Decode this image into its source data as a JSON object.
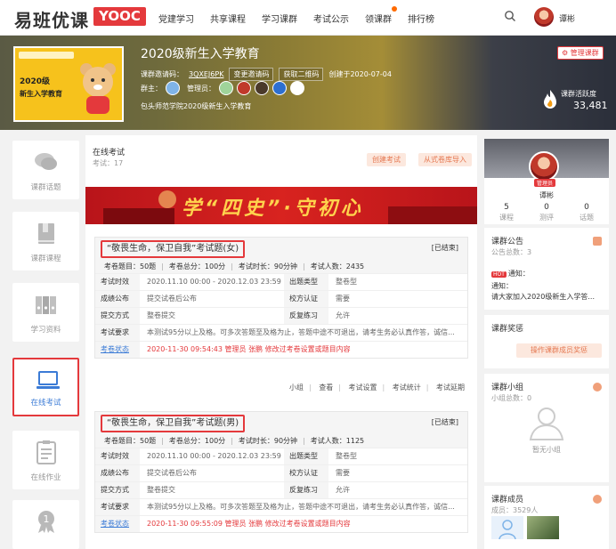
{
  "header": {
    "logo_text": "易班优课",
    "logo_badge": "YOOC",
    "nav": [
      "党建学习",
      "共享课程",
      "学习课群",
      "考试公示",
      "领课群",
      "排行榜"
    ],
    "user_name": "谭彬"
  },
  "banner": {
    "cover_line1": "2020级",
    "cover_line2": "新生入学教育",
    "title": "2020级新生入学教育",
    "invite_label": "课群邀请码：",
    "invite_code": "3QXEJ6PK",
    "change_code": "变更邀请码",
    "get_qr": "获取二维码",
    "created": "创建于2020-07-04",
    "owner_label": "群主：",
    "admin_label": "管理员：",
    "school": "包头师范学院2020级新生入学教育",
    "manage_button": "管理课群",
    "activity_label": "课群活跃度",
    "activity_value": "33,481"
  },
  "left_nav": [
    {
      "label": "课群话题",
      "icon": "chat-icon"
    },
    {
      "label": "课群课程",
      "icon": "book-icon"
    },
    {
      "label": "学习资料",
      "icon": "folder-icon"
    },
    {
      "label": "在线考试",
      "icon": "laptop-icon",
      "active": true
    },
    {
      "label": "在线作业",
      "icon": "clipboard-icon"
    },
    {
      "label": "",
      "icon": "medal-icon"
    }
  ],
  "main": {
    "section_title": "在线考试",
    "section_count": "考试：17",
    "create_exam": "创建考试",
    "import_exam": "从式卷库导入",
    "banner_text": "学“四史”·守初心",
    "exams": [
      {
        "title": "“敬畏生命，保卫自我”考试题(女)",
        "status": "[已结束]",
        "stats": [
          "考卷题目：50题",
          "考卷总分：100分",
          "考试时长：90分钟",
          "考试人数：2435"
        ],
        "time_label": "考试时效",
        "time_value": "2020.11.10 00:00 - 2020.12.03 23:59",
        "type_label": "出题类型",
        "type_value": "整卷型",
        "publish_label": "成绩公布",
        "publish_value": "提交试卷后公布",
        "verify_label": "校方认证",
        "verify_value": "需要",
        "submit_label": "提交方式",
        "submit_value": "整卷提交",
        "repeat_label": "反复练习",
        "repeat_value": "允许",
        "req_label": "考试要求",
        "req_value": "本测试95分以上及格。可多次答题至及格为止，答题中途不可退出，请考生务必认真作答，诚信...",
        "log_label": "考卷状态",
        "log_value": "2020-11-30 09:54:43 管理员 张鹏 修改过考卷设置或题目内容",
        "actions": [
          "小组",
          "查看",
          "考试设置",
          "考试统计",
          "考试延期"
        ]
      },
      {
        "title": "“敬畏生命，保卫自我”考试题(男)",
        "status": "[已结束]",
        "stats": [
          "考卷题目：50题",
          "考卷总分：100分",
          "考试时长：90分钟",
          "考试人数：1125"
        ],
        "time_label": "考试时效",
        "time_value": "2020.11.10 00:00 - 2020.12.03 23:59",
        "type_label": "出题类型",
        "type_value": "整卷型",
        "publish_label": "成绩公布",
        "publish_value": "提交试卷后公布",
        "verify_label": "校方认证",
        "verify_value": "需要",
        "submit_label": "提交方式",
        "submit_value": "整卷提交",
        "repeat_label": "反复练习",
        "repeat_value": "允许",
        "req_label": "考试要求",
        "req_value": "本测试95分以上及格。可多次答题至及格为止，答题中途不可退出，请考生务必认真作答，诚信...",
        "log_label": "考卷状态",
        "log_value": "2020-11-30 09:55:09 管理员 张鹏 修改过考卷设置或题目内容"
      }
    ]
  },
  "right": {
    "profile": {
      "badge": "管理员",
      "name": "谭彬",
      "stats": [
        {
          "n": "5",
          "l": "课程"
        },
        {
          "n": "0",
          "l": "测评"
        },
        {
          "n": "0",
          "l": "话题"
        }
      ]
    },
    "notice": {
      "title": "课群公告",
      "count": "公告总数：3",
      "hot": "HOT",
      "line1": "通知：",
      "line2": "通知：",
      "line3": "请大家加入2020级新生入学答..."
    },
    "awards": {
      "title": "课群奖惩",
      "button": "操作课群成员奖惩"
    },
    "groups": {
      "title": "课群小组",
      "count": "小组总数：0",
      "empty": "暂无小组"
    },
    "members": {
      "title": "课群成员",
      "count": "成员：3529人"
    }
  }
}
